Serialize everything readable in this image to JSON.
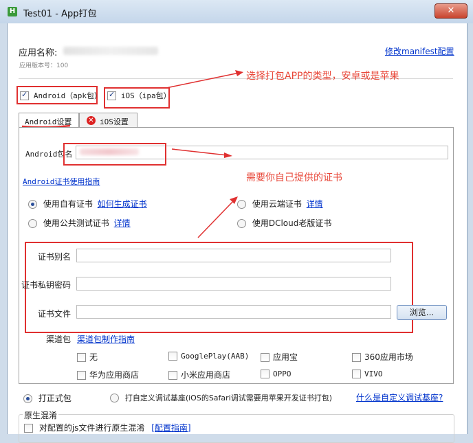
{
  "window": {
    "app_icon": "H",
    "title": "Test01 - App打包",
    "close_glyph": "✕"
  },
  "header": {
    "app_name_label": "应用名称:",
    "version_label": "应用版本号：100",
    "edit_manifest_link": "修改manifest配置"
  },
  "platforms": {
    "android_label": "Android（apk包）",
    "android_checked": true,
    "ios_label": "iOS（ipa包）",
    "ios_checked": true
  },
  "tabs": [
    {
      "label": "Android设置",
      "active": true
    },
    {
      "label": "iOS设置",
      "active": false
    }
  ],
  "android": {
    "package_label": "Android包名",
    "cert_guide_link": "Android证书使用指南",
    "cert_options": [
      {
        "label": "使用自有证书",
        "link": "如何生成证书",
        "selected": true
      },
      {
        "label": "使用公共测试证书",
        "link": "详情",
        "selected": false
      },
      {
        "label": "使用云端证书",
        "link": "详情",
        "selected": false
      },
      {
        "label": "使用DCloud老版证书",
        "link": "",
        "selected": false
      }
    ],
    "cert_alias_label": "证书别名",
    "cert_password_label": "证书私钥密码",
    "cert_file_label": "证书文件",
    "browse_button": "浏览...",
    "channel_label": "渠道包",
    "channel_guide_link": "渠道包制作指南",
    "channels": [
      "无",
      "GooglePlay(AAB)",
      "应用宝",
      "360应用市场",
      "华为应用商店",
      "小米应用商店",
      "OPPO",
      "VIVO"
    ]
  },
  "build": {
    "formal_label": "打正式包",
    "formal_selected": true,
    "custom_base_label": "打自定义调试基座(iOS的Safari调试需要用苹果开发证书打包)",
    "custom_base_link": "什么是自定义调试基座?"
  },
  "obfuscation": {
    "title": "原生混淆",
    "js_label": "对配置的js文件进行原生混淆",
    "config_link": "[配置指南]"
  },
  "annotations": {
    "choose_type": "选择打包APP的类型，安卓或是苹果",
    "own_cert": "需要你自己提供的证书"
  },
  "colors": {
    "annotation_red": "#e03030",
    "link_blue": "#0033cc",
    "title_bar": "#c4d6ea"
  }
}
